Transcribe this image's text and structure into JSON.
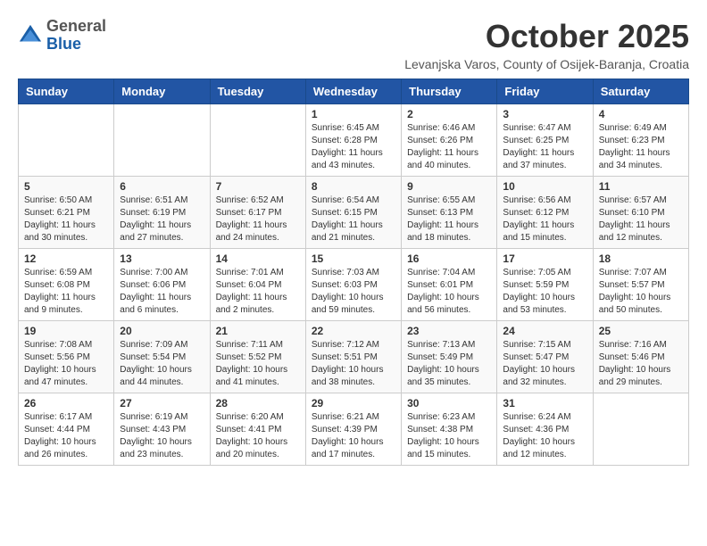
{
  "header": {
    "logo_general": "General",
    "logo_blue": "Blue",
    "month": "October 2025",
    "location": "Levanjska Varos, County of Osijek-Baranja, Croatia"
  },
  "weekdays": [
    "Sunday",
    "Monday",
    "Tuesday",
    "Wednesday",
    "Thursday",
    "Friday",
    "Saturday"
  ],
  "weeks": [
    [
      {
        "day": "",
        "info": ""
      },
      {
        "day": "",
        "info": ""
      },
      {
        "day": "",
        "info": ""
      },
      {
        "day": "1",
        "info": "Sunrise: 6:45 AM\nSunset: 6:28 PM\nDaylight: 11 hours\nand 43 minutes."
      },
      {
        "day": "2",
        "info": "Sunrise: 6:46 AM\nSunset: 6:26 PM\nDaylight: 11 hours\nand 40 minutes."
      },
      {
        "day": "3",
        "info": "Sunrise: 6:47 AM\nSunset: 6:25 PM\nDaylight: 11 hours\nand 37 minutes."
      },
      {
        "day": "4",
        "info": "Sunrise: 6:49 AM\nSunset: 6:23 PM\nDaylight: 11 hours\nand 34 minutes."
      }
    ],
    [
      {
        "day": "5",
        "info": "Sunrise: 6:50 AM\nSunset: 6:21 PM\nDaylight: 11 hours\nand 30 minutes."
      },
      {
        "day": "6",
        "info": "Sunrise: 6:51 AM\nSunset: 6:19 PM\nDaylight: 11 hours\nand 27 minutes."
      },
      {
        "day": "7",
        "info": "Sunrise: 6:52 AM\nSunset: 6:17 PM\nDaylight: 11 hours\nand 24 minutes."
      },
      {
        "day": "8",
        "info": "Sunrise: 6:54 AM\nSunset: 6:15 PM\nDaylight: 11 hours\nand 21 minutes."
      },
      {
        "day": "9",
        "info": "Sunrise: 6:55 AM\nSunset: 6:13 PM\nDaylight: 11 hours\nand 18 minutes."
      },
      {
        "day": "10",
        "info": "Sunrise: 6:56 AM\nSunset: 6:12 PM\nDaylight: 11 hours\nand 15 minutes."
      },
      {
        "day": "11",
        "info": "Sunrise: 6:57 AM\nSunset: 6:10 PM\nDaylight: 11 hours\nand 12 minutes."
      }
    ],
    [
      {
        "day": "12",
        "info": "Sunrise: 6:59 AM\nSunset: 6:08 PM\nDaylight: 11 hours\nand 9 minutes."
      },
      {
        "day": "13",
        "info": "Sunrise: 7:00 AM\nSunset: 6:06 PM\nDaylight: 11 hours\nand 6 minutes."
      },
      {
        "day": "14",
        "info": "Sunrise: 7:01 AM\nSunset: 6:04 PM\nDaylight: 11 hours\nand 2 minutes."
      },
      {
        "day": "15",
        "info": "Sunrise: 7:03 AM\nSunset: 6:03 PM\nDaylight: 10 hours\nand 59 minutes."
      },
      {
        "day": "16",
        "info": "Sunrise: 7:04 AM\nSunset: 6:01 PM\nDaylight: 10 hours\nand 56 minutes."
      },
      {
        "day": "17",
        "info": "Sunrise: 7:05 AM\nSunset: 5:59 PM\nDaylight: 10 hours\nand 53 minutes."
      },
      {
        "day": "18",
        "info": "Sunrise: 7:07 AM\nSunset: 5:57 PM\nDaylight: 10 hours\nand 50 minutes."
      }
    ],
    [
      {
        "day": "19",
        "info": "Sunrise: 7:08 AM\nSunset: 5:56 PM\nDaylight: 10 hours\nand 47 minutes."
      },
      {
        "day": "20",
        "info": "Sunrise: 7:09 AM\nSunset: 5:54 PM\nDaylight: 10 hours\nand 44 minutes."
      },
      {
        "day": "21",
        "info": "Sunrise: 7:11 AM\nSunset: 5:52 PM\nDaylight: 10 hours\nand 41 minutes."
      },
      {
        "day": "22",
        "info": "Sunrise: 7:12 AM\nSunset: 5:51 PM\nDaylight: 10 hours\nand 38 minutes."
      },
      {
        "day": "23",
        "info": "Sunrise: 7:13 AM\nSunset: 5:49 PM\nDaylight: 10 hours\nand 35 minutes."
      },
      {
        "day": "24",
        "info": "Sunrise: 7:15 AM\nSunset: 5:47 PM\nDaylight: 10 hours\nand 32 minutes."
      },
      {
        "day": "25",
        "info": "Sunrise: 7:16 AM\nSunset: 5:46 PM\nDaylight: 10 hours\nand 29 minutes."
      }
    ],
    [
      {
        "day": "26",
        "info": "Sunrise: 6:17 AM\nSunset: 4:44 PM\nDaylight: 10 hours\nand 26 minutes."
      },
      {
        "day": "27",
        "info": "Sunrise: 6:19 AM\nSunset: 4:43 PM\nDaylight: 10 hours\nand 23 minutes."
      },
      {
        "day": "28",
        "info": "Sunrise: 6:20 AM\nSunset: 4:41 PM\nDaylight: 10 hours\nand 20 minutes."
      },
      {
        "day": "29",
        "info": "Sunrise: 6:21 AM\nSunset: 4:39 PM\nDaylight: 10 hours\nand 17 minutes."
      },
      {
        "day": "30",
        "info": "Sunrise: 6:23 AM\nSunset: 4:38 PM\nDaylight: 10 hours\nand 15 minutes."
      },
      {
        "day": "31",
        "info": "Sunrise: 6:24 AM\nSunset: 4:36 PM\nDaylight: 10 hours\nand 12 minutes."
      },
      {
        "day": "",
        "info": ""
      }
    ]
  ]
}
